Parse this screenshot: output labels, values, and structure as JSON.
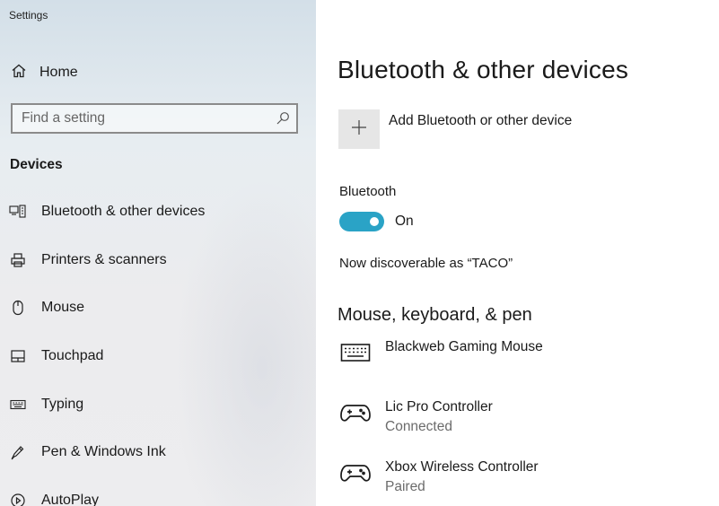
{
  "window": {
    "title": "Settings"
  },
  "sidebar": {
    "home_label": "Home",
    "search_placeholder": "Find a setting",
    "section_label": "Devices",
    "items": [
      {
        "label": "Bluetooth & other devices",
        "icon": "bluetooth-devices-icon"
      },
      {
        "label": "Printers & scanners",
        "icon": "printer-icon"
      },
      {
        "label": "Mouse",
        "icon": "mouse-icon"
      },
      {
        "label": "Touchpad",
        "icon": "touchpad-icon"
      },
      {
        "label": "Typing",
        "icon": "keyboard-icon"
      },
      {
        "label": "Pen & Windows Ink",
        "icon": "pen-icon"
      },
      {
        "label": "AutoPlay",
        "icon": "autoplay-icon"
      }
    ]
  },
  "main": {
    "title": "Bluetooth & other devices",
    "add_device_label": "Add Bluetooth or other device",
    "bluetooth": {
      "label": "Bluetooth",
      "state": "On",
      "enabled": true,
      "discoverable_text": "Now discoverable as “TACO”"
    },
    "group_heading": "Mouse, keyboard, & pen",
    "devices": [
      {
        "name": "Blackweb Gaming Mouse",
        "status": "",
        "icon": "keyboard-icon"
      },
      {
        "name": "Lic Pro Controller",
        "status": "Connected",
        "icon": "gamepad-icon"
      },
      {
        "name": "Xbox Wireless Controller",
        "status": "Paired",
        "icon": "gamepad-icon"
      }
    ]
  },
  "colors": {
    "accent": "#2aa3c6",
    "sidebar_bg": "#e9eef2",
    "tile_bg": "#e6e6e6"
  }
}
